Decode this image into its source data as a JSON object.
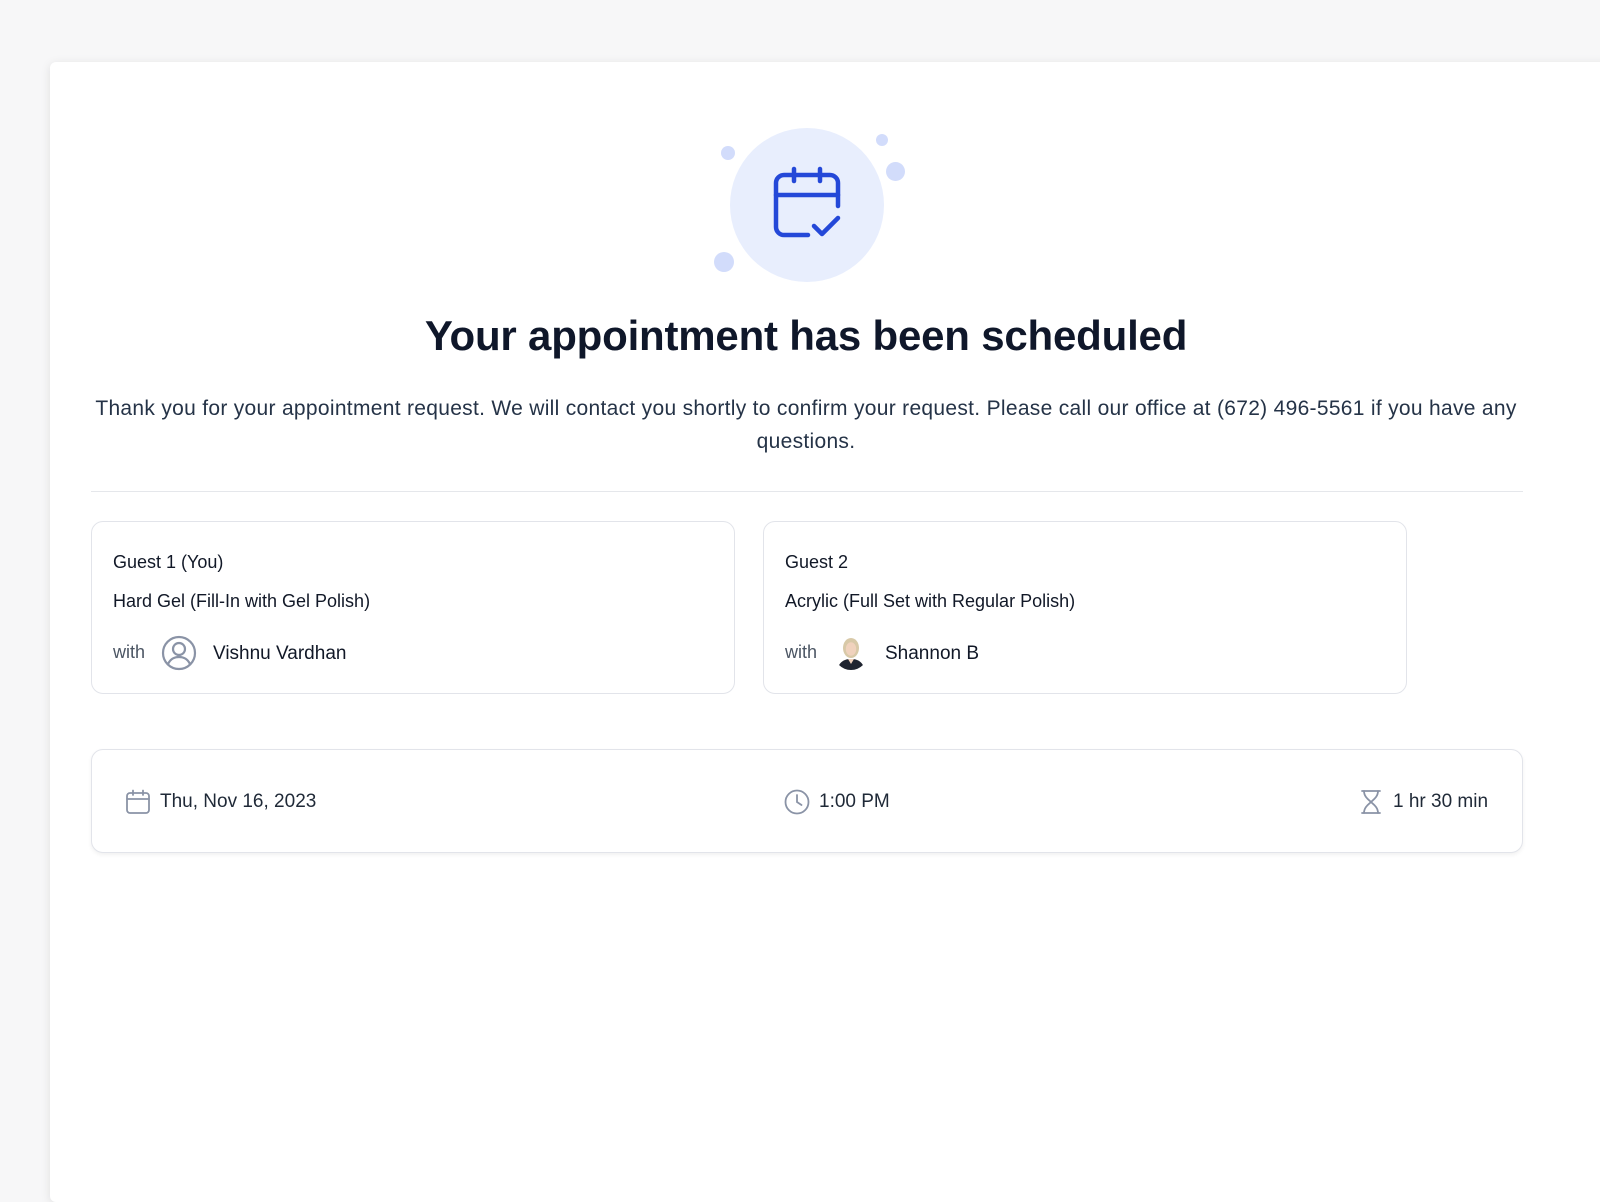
{
  "confirmation": {
    "title": "Your appointment has been scheduled",
    "message": "Thank you for your appointment request. We will contact you shortly to confirm your request. Please call our office at (672) 496-5561 if you have any questions.",
    "accent_color": "#2448d8",
    "icon": "calendar-check-icon"
  },
  "guests": [
    {
      "name": "Guest 1 (You)",
      "service": "Hard Gel (Fill-In with Gel Polish)",
      "with_label": "with",
      "staff": "Vishnu Vardhan",
      "avatar_icon": "user-circle-icon"
    },
    {
      "name": "Guest 2",
      "service": "Acrylic (Full Set with Regular Polish)",
      "with_label": "with",
      "staff": "Shannon B",
      "avatar_icon": "staff-photo-avatar"
    }
  ],
  "summary": {
    "date": "Thu, Nov 16, 2023",
    "time": "1:00 PM",
    "duration": "1 hr 30 min"
  }
}
